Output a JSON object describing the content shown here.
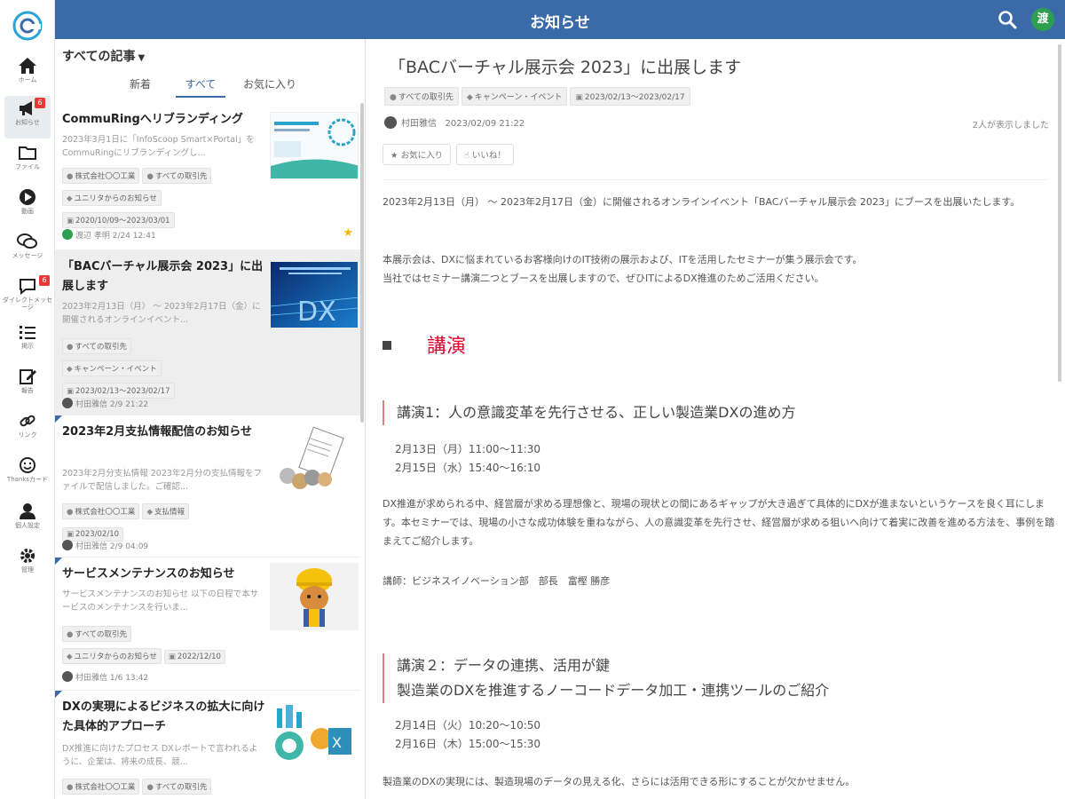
{
  "topbar": {
    "title": "お知らせ",
    "avatar": "渡"
  },
  "rail": [
    {
      "label": "ホーム",
      "icon": "home-icon"
    },
    {
      "label": "お知らせ",
      "icon": "megaphone-icon",
      "badge": "6",
      "active": true
    },
    {
      "label": "ファイル",
      "icon": "folder-icon"
    },
    {
      "label": "動画",
      "icon": "play-icon"
    },
    {
      "label": "メッセージ",
      "icon": "chat-icon"
    },
    {
      "label": "ダイレクトメッセージ",
      "icon": "dm-icon",
      "badge": "6"
    },
    {
      "label": "掲示",
      "icon": "list-icon"
    },
    {
      "label": "報告",
      "icon": "edit-icon"
    },
    {
      "label": "リンク",
      "icon": "link-icon"
    },
    {
      "label": "Thanksカード",
      "icon": "smile-icon"
    },
    {
      "label": "個人設定",
      "icon": "user-icon"
    },
    {
      "label": "管理",
      "icon": "gear-icon"
    }
  ],
  "list": {
    "filter": "すべての記事",
    "tabs": [
      "新着",
      "すべて",
      "お気に入り"
    ],
    "active_tab": 1,
    "cards": [
      {
        "title": "CommuRingへリブランディング",
        "excerpt": "2023年3月1日に「InfoScoop Smart×Portal」をCommuRingにリブランディングし...",
        "chips": [
          "株式会社〇〇工業",
          "すべての取引先",
          "ユニリタからのお知らせ",
          "2020/10/09〜2023/03/01"
        ],
        "author": "渡辺 孝明 2/24 12:41",
        "starred": true
      },
      {
        "title": "「BACバーチャル展示会 2023」に出展します",
        "excerpt": "2023年2月13日（月） 〜 2023年2月17日（金）に開催されるオンラインイベント...",
        "chips": [
          "すべての取引先",
          "キャンペーン・イベント",
          "2023/02/13〜2023/02/17"
        ],
        "author": "村田雅信 2/9 21:22",
        "selected": true
      },
      {
        "title": "2023年2月支払情報配信のお知らせ",
        "excerpt": "2023年2月分支払情報 2023年2月分の支払情報をファイルで配信しました。ご確認...",
        "chips": [
          "株式会社〇〇工業",
          "支払情報",
          "2023/02/10"
        ],
        "author": "村田雅信 2/9 04:09"
      },
      {
        "title": "サービスメンテナンスのお知らせ",
        "excerpt": "サービスメンテナンスのお知らせ 以下の日程で本サービスのメンテナンスを行いま...",
        "chips": [
          "すべての取引先",
          "ユニリタからのお知らせ",
          "2022/12/10"
        ],
        "author": "村田雅信 1/6 13:42"
      },
      {
        "title": "DXの実現によるビジネスの拡大に向けた具体的アプローチ",
        "excerpt": "DX推進に向けたプロセス DXレポートで言われるように、企業は、将来の成長、競...",
        "chips": [
          "株式会社〇〇工業",
          "すべての取引先"
        ],
        "author": ""
      }
    ]
  },
  "article": {
    "title": "「BACバーチャル展示会 2023」に出展します",
    "chips": [
      "すべての取引先",
      "キャンペーン・イベント",
      "2023/02/13〜2023/02/17"
    ],
    "author": "村田雅信",
    "date": "2023/02/09 21:22",
    "views": "2人が表示しました",
    "fav_button": "お気に入り",
    "like_button": "いいね！",
    "intro1": "2023年2月13日（月） 〜 2023年2月17日（金）に開催されるオンラインイベント「BACバーチャル展示会 2023」にブースを出展いたします。",
    "intro2": "本展示会は、DXに悩まれているお客様向けのIT技術の展示および、ITを活用したセミナーが集う展示会です。",
    "intro3": "当社ではセミナー講演二つとブースを出展しますので、ぜひITによるDX推進のためご活用ください。",
    "section": "講演",
    "talk1_title": "講演1：人の意識変革を先行させる、正しい製造業DXの進め方",
    "talk1_s1": "2月13日（月）11:00〜11:30",
    "talk1_s2": "2月15日（水）15:40〜16:10",
    "talk1_body": "DX推進が求められる中、経営層が求める理想像と、現場の現状との間にあるギャップが大き過ぎて具体的にDXが進まないというケースを良く耳にします。本セミナーでは、現場の小さな成功体験を重ねながら、人の意識変革を先行させ、経営層が求める狙いへ向けて着実に改善を進める方法を、事例を踏まえてご紹介します。",
    "talk1_speaker": "講師：ビジネスイノベーション部　部長　富樫 勝彦",
    "talk2_title1": "講演２：データの連携、活用が鍵",
    "talk2_title2": "製造業のDXを推進するノーコードデータ加工・連携ツールのご紹介",
    "talk2_s1": "2月14日（火）10:20〜10:50",
    "talk2_s2": "2月16日（木）15:00〜15:30",
    "talk2_body": "製造業のDXの実現には、製造現場のデータの見える化、さらには活用できる形にすることが欠かせません。"
  }
}
